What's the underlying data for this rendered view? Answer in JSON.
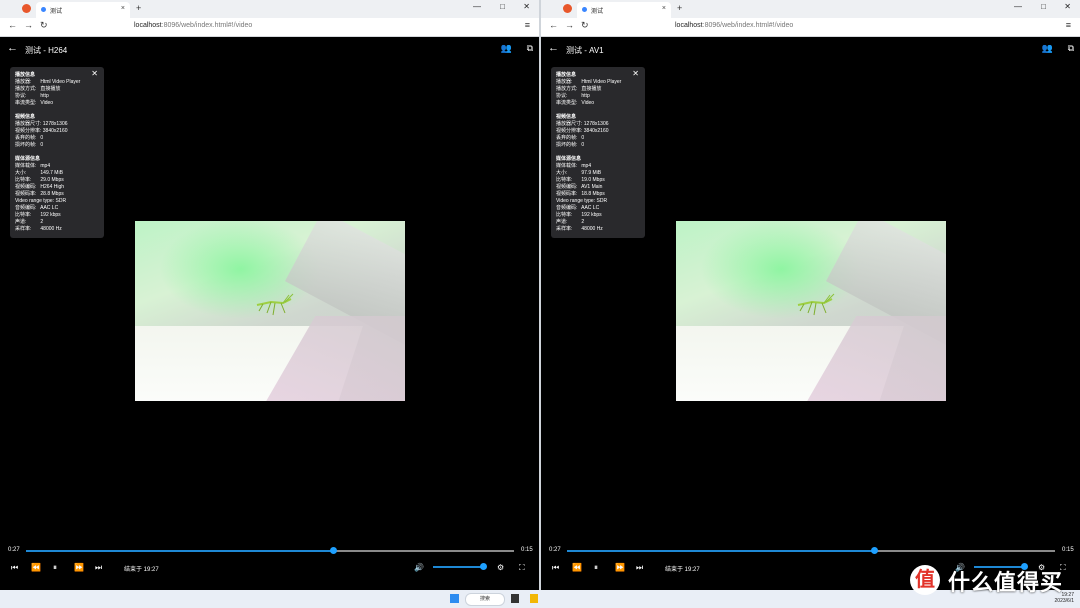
{
  "browser": {
    "tab_title": "测试",
    "tab_close": "×",
    "new_tab": "+",
    "url_host": "localhost",
    "url_path": ":8096/web/index.html#!/video",
    "nav_back": "←",
    "nav_forward": "→",
    "nav_reload": "↻",
    "window_min": "—",
    "window_max": "□",
    "window_close": "✕",
    "menu": "≡"
  },
  "players": [
    {
      "title": "测试 - H264",
      "info": {
        "player_section": "播放信息",
        "player_rows": [
          {
            "k": "播放器:",
            "v": "Html Video Player"
          },
          {
            "k": "播放方式:",
            "v": "直接播放"
          },
          {
            "k": "协议:",
            "v": "http"
          },
          {
            "k": "串流类型:",
            "v": "Video"
          }
        ],
        "video_section": "视频信息",
        "video_rows": [
          {
            "k": "播放器尺寸:",
            "v": "1278x1306"
          },
          {
            "k": "视频分辨率:",
            "v": "3840x2160"
          },
          {
            "k": "丢弃的帧:",
            "v": "0"
          },
          {
            "k": "损坏的帧:",
            "v": "0"
          }
        ],
        "media_section": "媒体源信息",
        "media_rows": [
          {
            "k": "媒体载体:",
            "v": "mp4"
          },
          {
            "k": "大小:",
            "v": "149.7 MiB"
          },
          {
            "k": "比特率:",
            "v": "29.0 Mbps"
          },
          {
            "k": "视频编码:",
            "v": "H264 High"
          },
          {
            "k": "视频码率:",
            "v": "28.8 Mbps"
          },
          {
            "k": "Video range type:",
            "v": "SDR"
          },
          {
            "k": "音频编码:",
            "v": "AAC LC"
          },
          {
            "k": "比特率:",
            "v": "192 kbps"
          },
          {
            "k": "声道:",
            "v": "2"
          },
          {
            "k": "采样率:",
            "v": "48000 Hz"
          }
        ]
      },
      "current_time": "0:27",
      "remaining_time": "0:15",
      "progress": 0.63,
      "volume": 1.0,
      "ends_at": "结束于 19:27"
    },
    {
      "title": "测试 - AV1",
      "info": {
        "player_section": "播放信息",
        "player_rows": [
          {
            "k": "播放器:",
            "v": "Html Video Player"
          },
          {
            "k": "播放方式:",
            "v": "直接播放"
          },
          {
            "k": "协议:",
            "v": "http"
          },
          {
            "k": "串流类型:",
            "v": "Video"
          }
        ],
        "video_section": "视频信息",
        "video_rows": [
          {
            "k": "播放器尺寸:",
            "v": "1278x1306"
          },
          {
            "k": "视频分辨率:",
            "v": "3840x2160"
          },
          {
            "k": "丢弃的帧:",
            "v": "0"
          },
          {
            "k": "损坏的帧:",
            "v": "0"
          }
        ],
        "media_section": "媒体源信息",
        "media_rows": [
          {
            "k": "媒体载体:",
            "v": "mp4"
          },
          {
            "k": "大小:",
            "v": "97.9 MiB"
          },
          {
            "k": "比特率:",
            "v": "19.0 Mbps"
          },
          {
            "k": "视频编码:",
            "v": "AV1 Main"
          },
          {
            "k": "视频码率:",
            "v": "18.8 Mbps"
          },
          {
            "k": "Video range type:",
            "v": "SDR"
          },
          {
            "k": "音频编码:",
            "v": "AAC LC"
          },
          {
            "k": "比特率:",
            "v": "192 kbps"
          },
          {
            "k": "声道:",
            "v": "2"
          },
          {
            "k": "采样率:",
            "v": "48000 Hz"
          }
        ]
      },
      "current_time": "0:27",
      "remaining_time": "0:15",
      "progress": 0.63,
      "volume": 1.0,
      "ends_at": "结束于 19:27"
    }
  ],
  "controls": {
    "info_close": "✕",
    "skip_prev": "⏮",
    "rewind": "⏪",
    "pause": "⏸",
    "fast_forward": "⏩",
    "skip_next": "⏭",
    "volume": "🔊",
    "settings": "⚙",
    "fullscreen": "⛶",
    "cast": "⧉",
    "users": "👥"
  },
  "taskbar": {
    "search_label": "搜索",
    "time": "19:27",
    "date": "2023/6/1"
  },
  "watermark": {
    "badge": "值",
    "text": "什么值得买"
  },
  "colors": {
    "accent": "#1e88d4",
    "background": "#000000"
  }
}
